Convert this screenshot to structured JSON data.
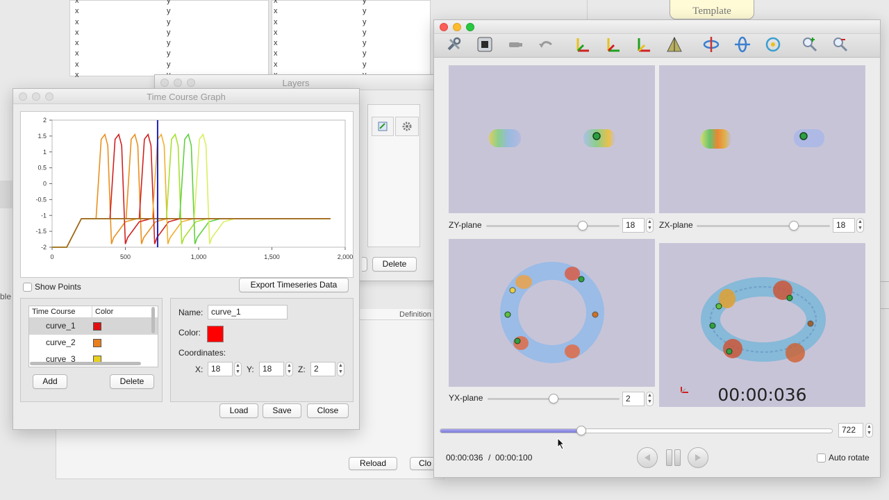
{
  "background": {
    "spreadsheet_x": [
      "x",
      "x",
      "x",
      "x",
      "x",
      "x",
      "x",
      "x"
    ],
    "spreadsheet_y": [
      "y",
      "y",
      "y",
      "y",
      "y",
      "y",
      "y",
      "y"
    ],
    "template_label": "Template",
    "definition_label": "Definition",
    "reload_label": "Reload",
    "close_partial": "Clo",
    "edge_label": "ble"
  },
  "layers": {
    "title": "Layers",
    "delete_label": "Delete"
  },
  "tcg": {
    "title": "Time Course Graph",
    "show_points_label": "Show Points",
    "export_label": "Export Timeseries Data",
    "table_headers": [
      "Time Course",
      "Color"
    ],
    "curves": [
      {
        "name": "curve_1",
        "color": "#e01010"
      },
      {
        "name": "curve_2",
        "color": "#e8801e"
      },
      {
        "name": "curve_3",
        "color": "#e8d01e"
      }
    ],
    "add_label": "Add",
    "delete_label": "Delete",
    "name_label": "Name:",
    "name_value": "curve_1",
    "color_label": "Color:",
    "selected_color": "#ff0000",
    "coords_label": "Coordinates:",
    "x_label": "X:",
    "x_value": "18",
    "y_label": "Y:",
    "y_value": "18",
    "z_label": "Z:",
    "z_value": "2",
    "load_label": "Load",
    "save_label": "Save",
    "close_label": "Close"
  },
  "chart_data": {
    "type": "line",
    "xlim": [
      0,
      2000
    ],
    "ylim": [
      -2,
      2
    ],
    "x_ticks": [
      "0",
      "500",
      "1,000",
      "1,500",
      "2,000"
    ],
    "y_ticks": [
      "2",
      "1.5",
      "1",
      "0.5",
      "0",
      "-0.5",
      "-1",
      "-1.5",
      "-2"
    ],
    "cursor_x": 720,
    "cursor_color": "#1a20b8",
    "grid": false,
    "series": [
      {
        "color": "#e8901e",
        "peaks": [
          360,
          565
        ]
      },
      {
        "color": "#d02020",
        "peaks": [
          455,
          655
        ]
      },
      {
        "color": "#f0b030",
        "peaks": [
          745
        ]
      },
      {
        "color": "#a8e030",
        "peaks": [
          840
        ]
      },
      {
        "color": "#60d040",
        "peaks": [
          930
        ]
      },
      {
        "color": "#d8f060",
        "peaks": [
          1030
        ]
      },
      {
        "color": "#a0601e",
        "peaks": []
      }
    ]
  },
  "viewer": {
    "zy_label": "ZY-plane",
    "zy_value": "18",
    "zx_label": "ZX-plane",
    "zx_value": "18",
    "yx_label": "YX-plane",
    "yx_value": "2",
    "timestamp": "00:00:036",
    "progress_fraction": 0.36,
    "frame_value": "722",
    "time_current": "00:00:036",
    "time_separator": "/",
    "time_total": "00:00:100",
    "auto_rotate_label": "Auto rotate",
    "toolbar_icons": [
      "wrench-icon",
      "stop-icon",
      "camera-icon",
      "undo-icon",
      "axis-zy-icon",
      "axis-zx-icon",
      "axis-yx-icon",
      "perspective-icon",
      "rotate-x-icon",
      "rotate-y-icon",
      "rotate-z-icon",
      "zoom-in-icon",
      "zoom-out-icon"
    ]
  }
}
